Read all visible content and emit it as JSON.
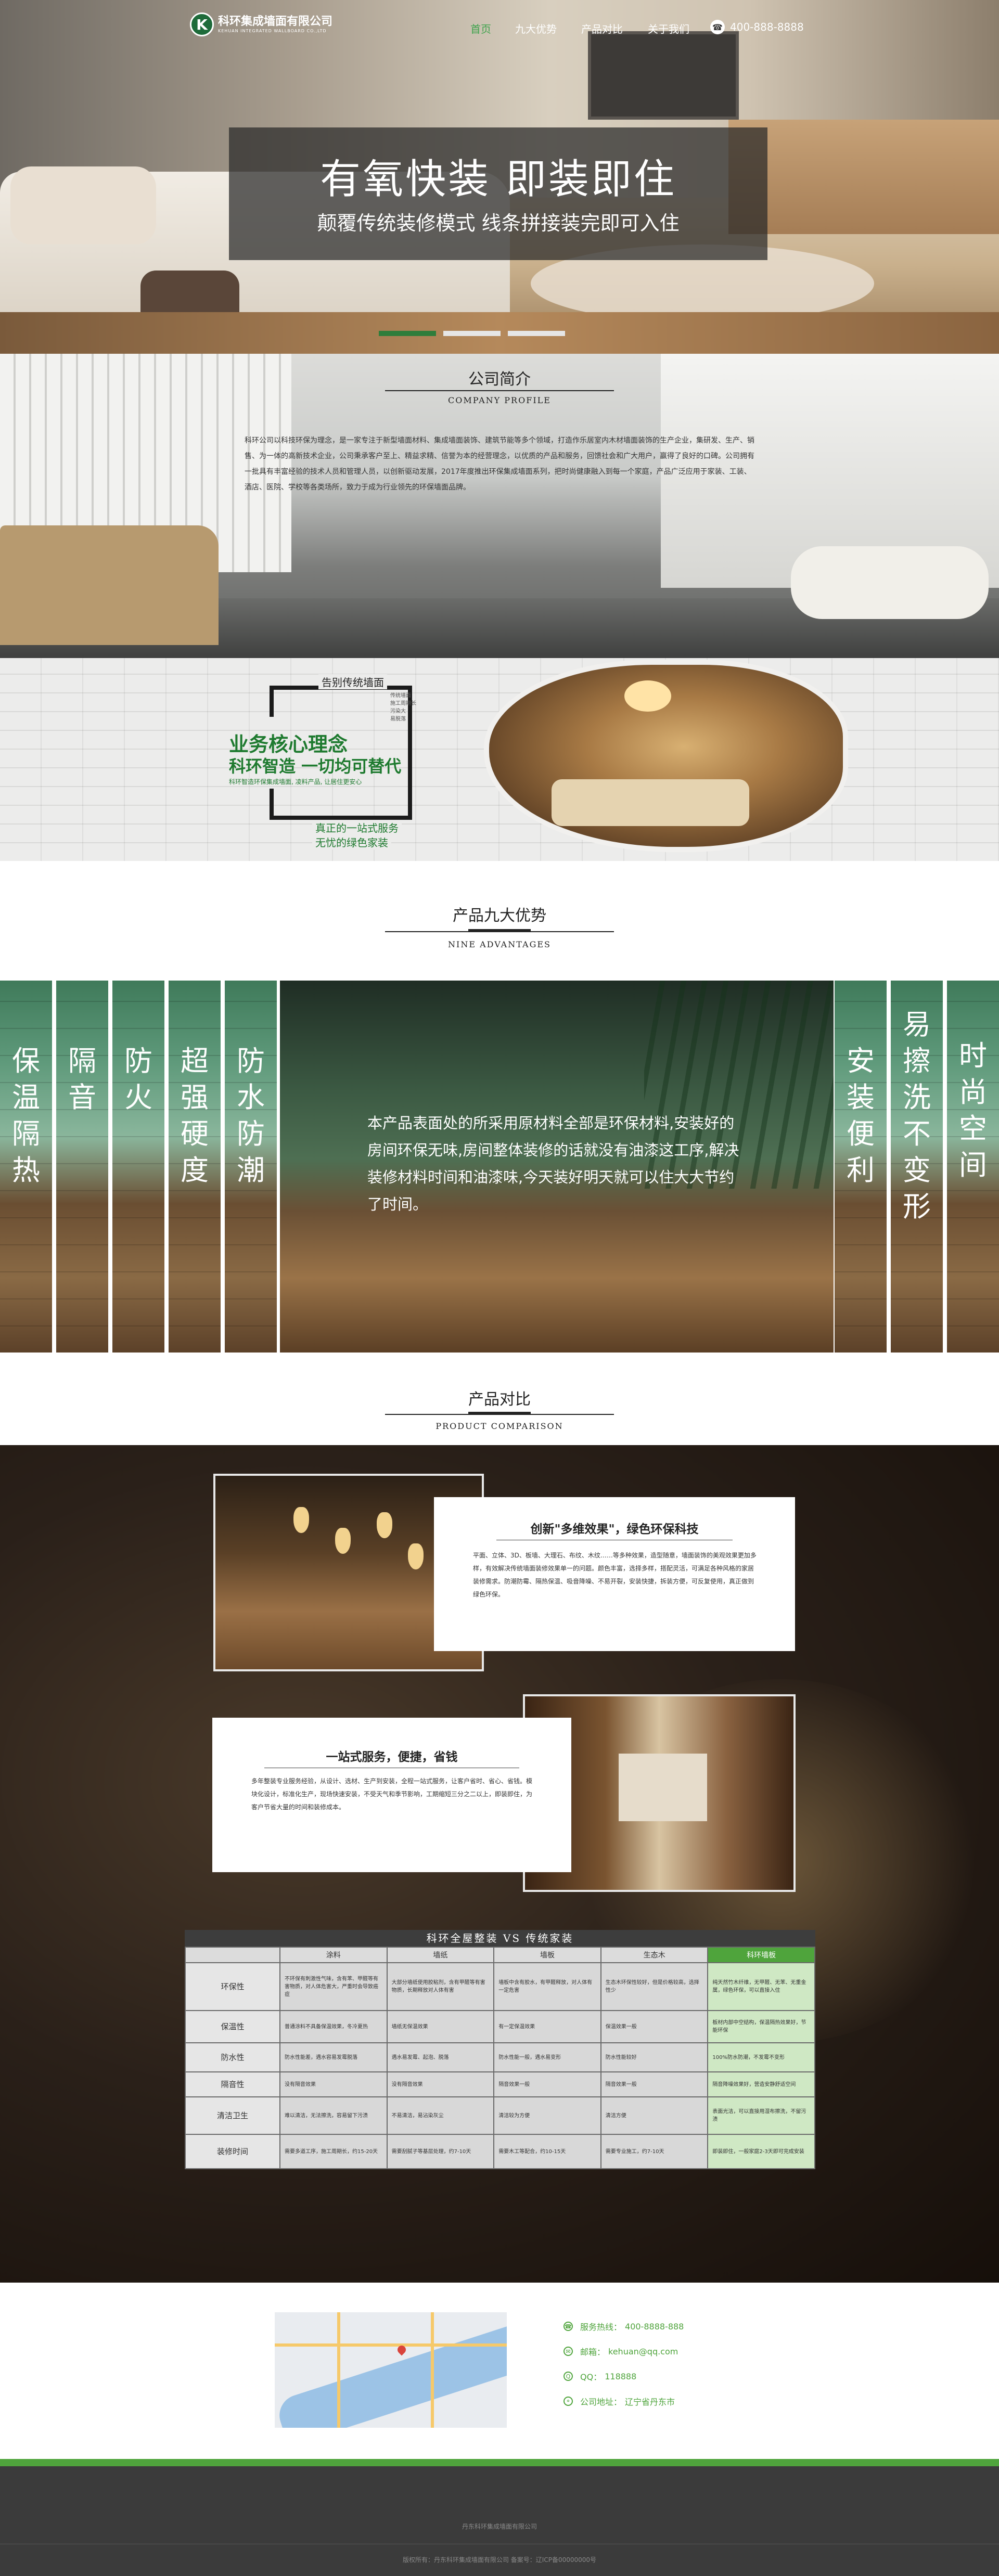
{
  "logo": {
    "name": "科环集成墙面有限公司",
    "tagline": "KEHUAN INTEGRATED WALLBOARD CO.,LTD"
  },
  "nav": {
    "items": [
      {
        "label": "首页",
        "active": true
      },
      {
        "label": "九大优势",
        "active": false
      },
      {
        "label": "产品对比",
        "active": false
      },
      {
        "label": "关于我们",
        "active": false
      }
    ],
    "phone": "400-888-8888"
  },
  "hero": {
    "title": "有氧快装  即装即住",
    "subtitle": "颠覆传统装修模式 线条拼接装完即可入住",
    "active_slide": 0,
    "slide_count": 3
  },
  "profile": {
    "title": "公司简介",
    "title_en": "COMPANY PROFILE",
    "text": "科环公司以科技环保为理念，是一家专注于新型墙面材料、集成墙面装饰、建筑节能等多个领域，打造作乐居室内木材墙面装饰的生产企业，集研发、生产、销售、为一体的高新技术企业，公司秉承客户至上、精益求精、信誉为本的经营理念，以优质的产品和服务，回馈社会和广大用户，赢得了良好的口碑。公司拥有一批具有丰富经验的技术人员和管理人员，以创新驱动发展，2017年度推出环保集成墙面系列，把时尚健康融入到每一个家庭，产品广泛应用于家装、工装、酒店、医院、学校等各类场所，致力于成为行业领先的环保墙面品牌。"
  },
  "core": {
    "farewell": "告别传统墙面",
    "heading": "业务核心理念",
    "subheading": "科环智造 一切均可替代",
    "small_text": "科环智造环保集成墙面, 凌料产品, 让居住更安心",
    "side_text": [
      "传统墙面",
      "施工周期长",
      "污染大",
      "易脱落"
    ],
    "bottom1": "真正的一站式服务",
    "bottom2": "无忧的绿色家装"
  },
  "nine": {
    "title": "产品九大优势",
    "title_en": "NINE ADVANTAGES",
    "left_strips": [
      "保温隔热",
      "隔音",
      "防火",
      "超强硬度",
      "防水防潮"
    ],
    "right_strips": [
      "安装便利",
      "易擦洗不变形",
      "时尚空间"
    ],
    "center_text": "本产品表面处的所采用原材料全部是环保材料,安装好的房间环保无味,房间整体装修的话就没有油漆这工序,解决装修材料时间和油漆味,今天装好明天就可以住大大节约了时间。"
  },
  "comparison": {
    "title": "产品对比",
    "title_en": "PRODUCT COMPARISON",
    "card1": {
      "title": "创新\"多维效果\"，绿色环保科技",
      "text": "平面、立体、3D、板墙、大理石、布纹、木纹……等多种效果，造型随意，墙面装饰的美观效果更加多样，有效解决传统墙面装修效果单一的问题。颜色丰富，选择多样，搭配灵活，可满足各种风格的家居装修需求。防潮防霉、隔热保温、吸音降噪、不易开裂，安装快捷，拆装方便，可反复使用，真正做到绿色环保。"
    },
    "card2": {
      "title": "一站式服务，便捷，省钱",
      "text": "多年整装专业服务经验，从设计、选材、生产到安装，全程一站式服务，让客户省时、省心、省钱。模块化设计，标准化生产，现场快速安装，不受天气和季节影响，工期缩短三分之二以上，即装即住，为客户节省大量的时间和装修成本。"
    },
    "table": {
      "title": "科环全屋整装 VS 传统家装",
      "headers": [
        "",
        "涂料",
        "墙纸",
        "墙板",
        "生态木",
        "科环墙板"
      ],
      "rows": [
        {
          "label": "环保性",
          "cells": [
            "不环保有刺激性气味，含有苯、甲醛等有害物质，对人体危害大，严重时会导致癌症",
            "大部分墙纸使用胶粘剂，含有甲醛等有害物质，长期释放对人体有害",
            "墙板中含有胶水，有甲醛释放，对人体有一定危害",
            "生态木环保性较好，但是价格较高，选择性少",
            "纯天然竹木纤维，无甲醛、无苯、无重金属，绿色环保，可以直接入住"
          ]
        },
        {
          "label": "保温性",
          "cells": [
            "普通涂料不具备保温效果，冬冷夏热",
            "墙纸无保温效果",
            "有一定保温效果",
            "保温效果一般",
            "板材内部中空结构，保温隔热效果好，节能环保"
          ]
        },
        {
          "label": "防水性",
          "cells": [
            "防水性能差，遇水容易发霉脱落",
            "遇水易发霉、起泡、脱落",
            "防水性能一般，遇水易变形",
            "防水性能较好",
            "100%防水防潮，不发霉不变形"
          ]
        },
        {
          "label": "隔音性",
          "cells": [
            "没有隔音效果",
            "没有隔音效果",
            "隔音效果一般",
            "隔音效果一般",
            "隔音降噪效果好，营造安静舒适空间"
          ]
        },
        {
          "label": "清洁卫生",
          "cells": [
            "难以清洁，无法擦洗，容易留下污渍",
            "不易清洁，易沾染灰尘",
            "清洁较为方便",
            "清洁方便",
            "表面光洁，可以直接用湿布擦洗，不留污渍"
          ]
        },
        {
          "label": "装修时间",
          "cells": [
            "需要多道工序，施工周期长，约15-20天",
            "需要刮腻子等基层处理，约7-10天",
            "需要木工等配合，约10-15天",
            "需要专业施工，约7-10天",
            "即装即住，一般家庭2-3天即可完成安装"
          ]
        }
      ]
    }
  },
  "contact": {
    "items": [
      {
        "icon": "phone-icon",
        "label": "服务热线：",
        "value": "400-8888-888"
      },
      {
        "icon": "email-icon",
        "label": "邮箱：",
        "value": "kehuan@qq.com"
      },
      {
        "icon": "qq-icon",
        "label": "QQ：",
        "value": "118888"
      },
      {
        "icon": "location-icon",
        "label": "公司地址：",
        "value": "辽宁省丹东市"
      }
    ]
  },
  "footer": {
    "copyright": "丹东科环集成墙面有限公司",
    "icp": "版权所有：丹东科环集成墙面有限公司   备案号：辽ICP备00000000号"
  },
  "colors": {
    "accent": "#4fa43c",
    "dark_green": "#1e7a2f",
    "footer": "#3b3b3b"
  }
}
